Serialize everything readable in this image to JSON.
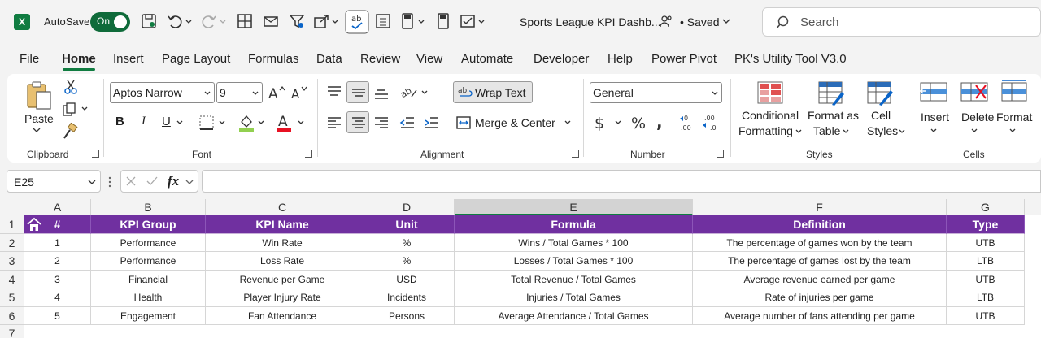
{
  "titlebar": {
    "app_icon": "excel-icon",
    "autosave_label": "AutoSave",
    "autosave_state": "On",
    "doc_title": "Sports League KPI Dashb...",
    "saved_status": "• Saved",
    "search_placeholder": "Search"
  },
  "menu": [
    "File",
    "Home",
    "Insert",
    "Page Layout",
    "Formulas",
    "Data",
    "Review",
    "View",
    "Automate",
    "Developer",
    "Help",
    "Power Pivot",
    "PK's Utility Tool V3.0"
  ],
  "ribbon": {
    "clipboard": {
      "label": "Clipboard",
      "paste": "Paste"
    },
    "font": {
      "label": "Font",
      "font_name": "Aptos Narrow",
      "font_size": "9",
      "bold": "B",
      "italic": "I",
      "underline": "U"
    },
    "alignment": {
      "label": "Alignment",
      "wrap_text": "Wrap Text",
      "merge_center": "Merge & Center"
    },
    "number": {
      "label": "Number",
      "format": "General"
    },
    "styles": {
      "label": "Styles",
      "conditional_1": "Conditional",
      "conditional_2": "Formatting",
      "format_table_1": "Format as",
      "format_table_2": "Table",
      "cell_styles_1": "Cell",
      "cell_styles_2": "Styles"
    },
    "cells": {
      "label": "Cells",
      "insert": "Insert",
      "delete": "Delete",
      "format": "Format"
    }
  },
  "formula_bar": {
    "name_box": "E25",
    "fx": "fx",
    "content": ""
  },
  "columns": [
    "A",
    "B",
    "C",
    "D",
    "E",
    "F",
    "G"
  ],
  "rows": [
    "1",
    "2",
    "3",
    "4",
    "5",
    "6",
    "7"
  ],
  "table": {
    "headers": [
      "#",
      "KPI Group",
      "KPI Name",
      "Unit",
      "Formula",
      "Definition",
      "Type"
    ],
    "rows": [
      [
        "1",
        "Performance",
        "Win Rate",
        "%",
        "Wins / Total Games * 100",
        "The percentage of games won by the team",
        "UTB"
      ],
      [
        "2",
        "Performance",
        "Loss Rate",
        "%",
        "Losses / Total Games * 100",
        "The percentage of games lost by the team",
        "LTB"
      ],
      [
        "3",
        "Financial",
        "Revenue per Game",
        "USD",
        "Total Revenue / Total Games",
        "Average revenue earned per game",
        "UTB"
      ],
      [
        "4",
        "Health",
        "Player Injury Rate",
        "Incidents",
        "Injuries / Total Games",
        "Rate of injuries per game",
        "LTB"
      ],
      [
        "5",
        "Engagement",
        "Fan Attendance",
        "Persons",
        "Average Attendance / Total Games",
        "Average number of fans attending per game",
        "UTB"
      ]
    ]
  },
  "colors": {
    "accent": "#107c41",
    "header_fill": "#7030a0"
  }
}
